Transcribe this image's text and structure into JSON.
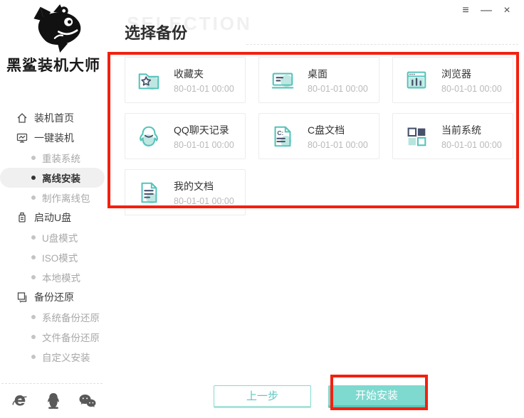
{
  "window": {
    "menu_glyph": "≡",
    "minimize_glyph": "—",
    "close_glyph": "×"
  },
  "app": {
    "title": "黑鲨装机大师"
  },
  "sidebar": {
    "items": [
      {
        "label": "装机首页",
        "type": "section",
        "icon": "home-icon",
        "state": "normal"
      },
      {
        "label": "一键装机",
        "type": "section",
        "icon": "monitor-chart-icon",
        "state": "normal"
      },
      {
        "label": "重装系统",
        "type": "sub",
        "state": "muted"
      },
      {
        "label": "离线安装",
        "type": "sub",
        "state": "selected"
      },
      {
        "label": "制作离线包",
        "type": "sub",
        "state": "muted"
      },
      {
        "label": "启动U盘",
        "type": "section",
        "icon": "usb-drive-icon",
        "state": "normal"
      },
      {
        "label": "U盘模式",
        "type": "sub",
        "state": "muted"
      },
      {
        "label": "ISO模式",
        "type": "sub",
        "state": "muted"
      },
      {
        "label": "本地模式",
        "type": "sub",
        "state": "muted"
      },
      {
        "label": "备份还原",
        "type": "section",
        "icon": "backup-restore-icon",
        "state": "normal"
      },
      {
        "label": "系统备份还原",
        "type": "sub",
        "state": "muted"
      },
      {
        "label": "文件备份还原",
        "type": "sub",
        "state": "muted"
      },
      {
        "label": "自定义安装",
        "type": "sub",
        "state": "muted"
      }
    ],
    "footer_icons": [
      {
        "name": "ie-icon"
      },
      {
        "name": "qq-icon"
      },
      {
        "name": "wechat-icon"
      }
    ]
  },
  "page": {
    "watermark": "SELECTION",
    "title": "选择备份"
  },
  "cards": [
    {
      "label": "收藏夹",
      "date": "80-01-01 00:00",
      "icon": "favorites-folder-icon"
    },
    {
      "label": "桌面",
      "date": "80-01-01 00:00",
      "icon": "desktop-icon"
    },
    {
      "label": "浏览器",
      "date": "80-01-01 00:00",
      "icon": "browser-icon"
    },
    {
      "label": "QQ聊天记录",
      "date": "80-01-01 00:00",
      "icon": "qq-penguin-icon"
    },
    {
      "label": "C盘文档",
      "date": "80-01-01 00:00",
      "icon": "c-drive-doc-icon"
    },
    {
      "label": "当前系统",
      "date": "80-01-01 00:00",
      "icon": "current-system-icon"
    },
    {
      "label": "我的文档",
      "date": "80-01-01 00:00",
      "icon": "my-documents-icon"
    }
  ],
  "footer": {
    "prev_label": "上一步",
    "start_label": "开始安装"
  },
  "colors": {
    "accent_teal": "#5fc5bd",
    "accent_navy": "#46516b",
    "annotation_red": "#f3200f",
    "button_fill": "#7ed9cf",
    "muted_text": "#a8a8a8",
    "date_text": "#b9b9b9"
  }
}
